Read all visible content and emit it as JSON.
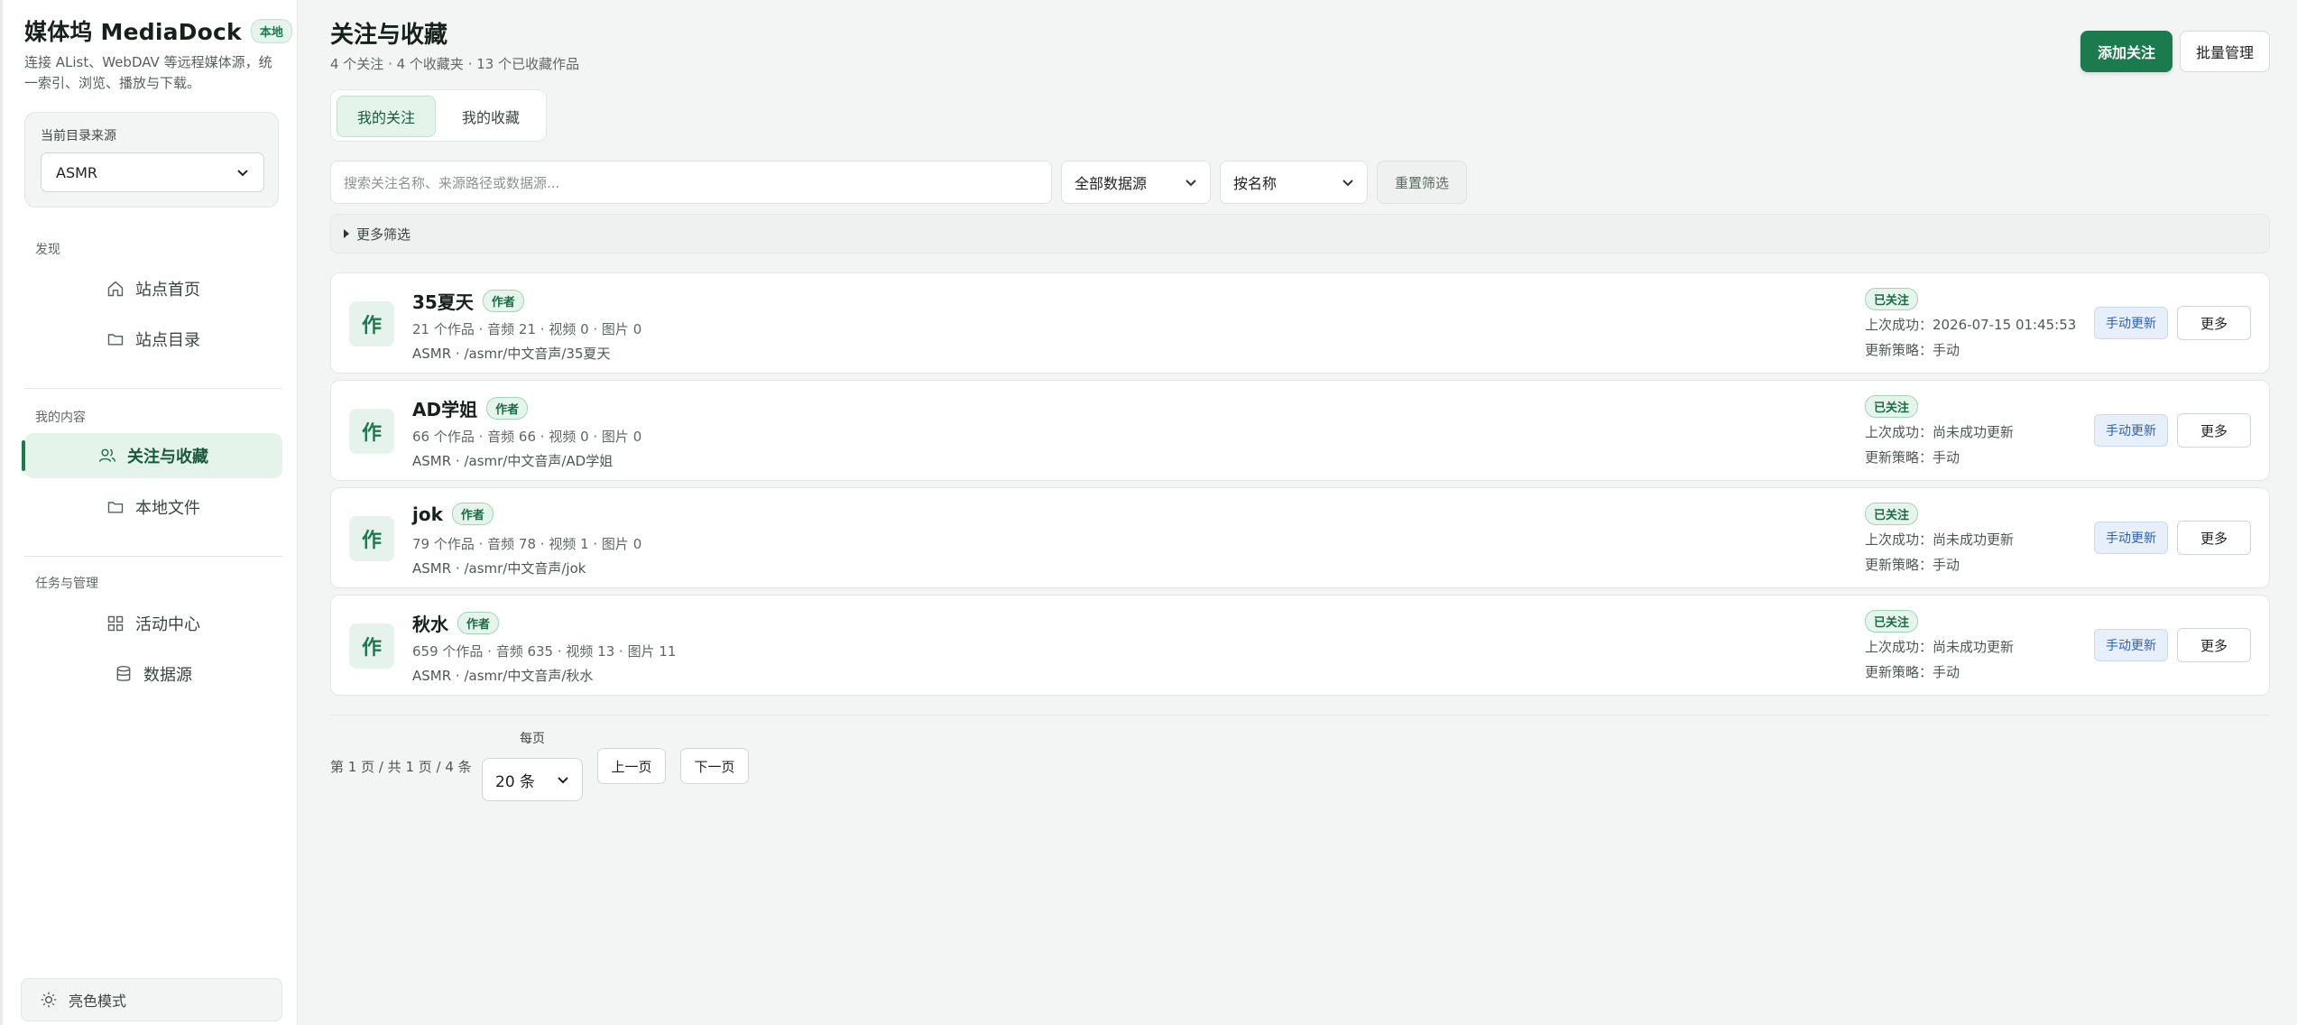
{
  "sidebar": {
    "brand_title": "媒体坞 MediaDock",
    "brand_badge": "本地",
    "brand_desc": "连接 AList、WebDAV 等远程媒体源，统一索引、浏览、播放与下载。",
    "source_label": "当前目录来源",
    "source_value": "ASMR",
    "sections": {
      "discover": "发现",
      "my_content": "我的内容",
      "tasks": "任务与管理"
    },
    "items": [
      {
        "label": "站点首页",
        "icon": "home-icon"
      },
      {
        "label": "站点目录",
        "icon": "folder-icon"
      },
      {
        "label": "关注与收藏",
        "icon": "users-icon",
        "active": true
      },
      {
        "label": "本地文件",
        "icon": "folder-icon"
      },
      {
        "label": "活动中心",
        "icon": "grid-icon"
      },
      {
        "label": "数据源",
        "icon": "database-icon"
      }
    ],
    "theme_label": "亮色模式"
  },
  "header": {
    "title": "关注与收藏",
    "subtitle": "4 个关注 · 4 个收藏夹 · 13 个已收藏作品",
    "add_button": "添加关注",
    "batch_button": "批量管理"
  },
  "tabs": [
    {
      "label": "我的关注",
      "active": true
    },
    {
      "label": "我的收藏",
      "active": false
    }
  ],
  "filters": {
    "search_placeholder": "搜索关注名称、来源路径或数据源...",
    "source_filter": "全部数据源",
    "sort": "按名称",
    "reset": "重置筛选",
    "more": "更多筛选"
  },
  "follows": [
    {
      "avatar": "作",
      "name": "35夏天",
      "tag": "作者",
      "stats": "21 个作品 · 音频 21 · 视频 0 · 图片 0",
      "path": "ASMR · /asmr/中文音声/35夏天",
      "status": "已关注",
      "last": "上次成功：2026-07-15 01:45:53",
      "policy": "更新策略：手动",
      "refresh": "手动更新",
      "more": "更多"
    },
    {
      "avatar": "作",
      "name": "AD学姐",
      "tag": "作者",
      "stats": "66 个作品 · 音频 66 · 视频 0 · 图片 0",
      "path": "ASMR · /asmr/中文音声/AD学姐",
      "status": "已关注",
      "last": "上次成功：尚未成功更新",
      "policy": "更新策略：手动",
      "refresh": "手动更新",
      "more": "更多"
    },
    {
      "avatar": "作",
      "name": "jok",
      "tag": "作者",
      "stats": "79 个作品 · 音频 78 · 视频 1 · 图片 0",
      "path": "ASMR · /asmr/中文音声/jok",
      "status": "已关注",
      "last": "上次成功：尚未成功更新",
      "policy": "更新策略：手动",
      "refresh": "手动更新",
      "more": "更多"
    },
    {
      "avatar": "作",
      "name": "秋水",
      "tag": "作者",
      "stats": "659 个作品 · 音频 635 · 视频 13 · 图片 11",
      "path": "ASMR · /asmr/中文音声/秋水",
      "status": "已关注",
      "last": "上次成功：尚未成功更新",
      "policy": "更新策略：手动",
      "refresh": "手动更新",
      "more": "更多"
    }
  ],
  "pager": {
    "info": "第 1 页 / 共 1 页 / 4 条",
    "per_page_label": "每页",
    "per_page": "20 条",
    "prev": "上一页",
    "next": "下一页"
  },
  "colors": {
    "accent": "#1b7a4e",
    "accent_light": "#e4f4ea",
    "refresh_blue": "#2f5fb3"
  }
}
